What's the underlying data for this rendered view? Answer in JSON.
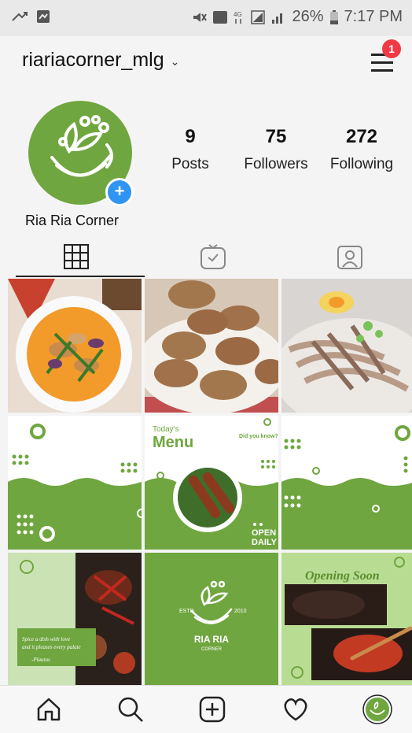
{
  "status": {
    "battery": "26%",
    "time": "7:17 PM"
  },
  "profile": {
    "username": "riariacorner_mlg",
    "notification_count": "1",
    "posts_count": "9",
    "posts_label": "Posts",
    "followers_count": "75",
    "followers_label": "Followers",
    "following_count": "272",
    "following_label": "Following",
    "display_name": "Ria Ria Corner"
  },
  "posts": {
    "menu_title_small": "Today's",
    "menu_title_big": "Menu",
    "did_you_know": "Did you know?",
    "open_daily": "OPEN\nDAILY",
    "estd": "ESTD",
    "year": "2010",
    "brand": "RIA RIA",
    "brand_sub": "CORNER",
    "opening_soon": "Opening Soon",
    "quote": "Spice a dish with love and it pleases every palate",
    "quote_author": "-Plautus"
  },
  "colors": {
    "brand_green": "#6fa63f",
    "badge_red": "#ee3a45",
    "plus_blue": "#2f95f0"
  }
}
